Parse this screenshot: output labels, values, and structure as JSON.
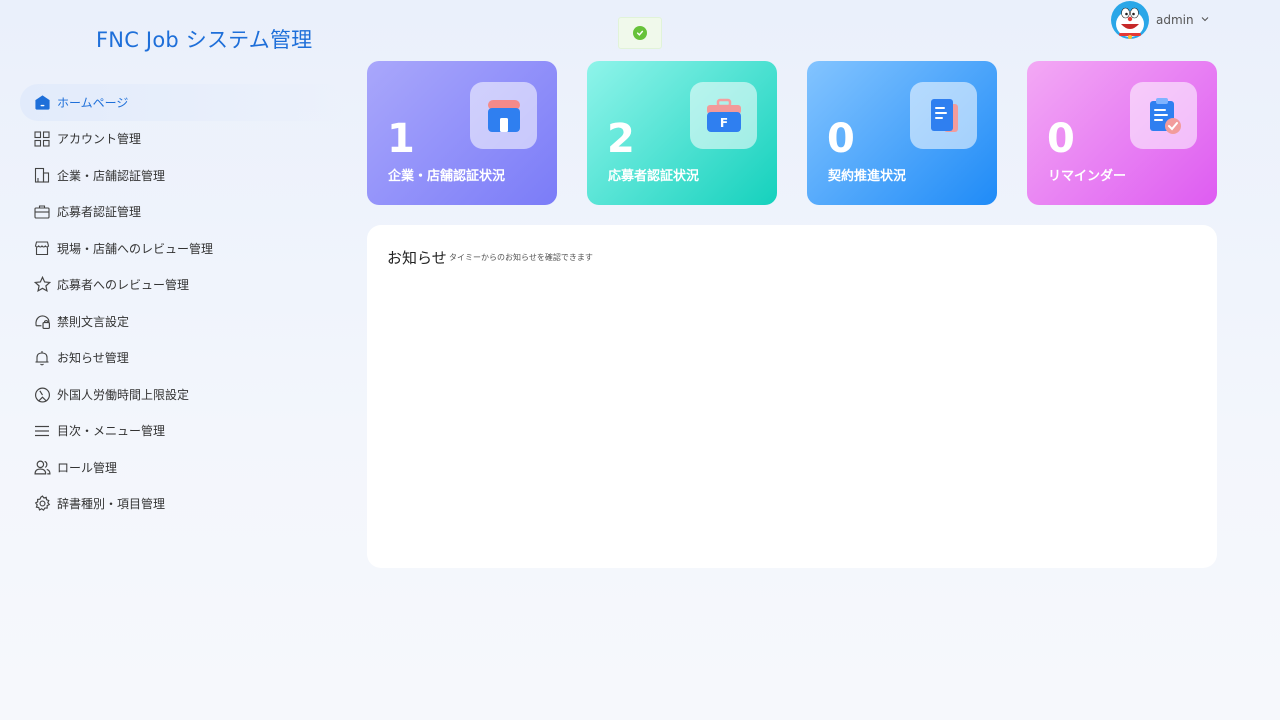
{
  "app": {
    "title": "FNC Job システム管理"
  },
  "user": {
    "name": "admin"
  },
  "sidebar": {
    "items": [
      {
        "label": "ホームページ",
        "icon": "home-icon",
        "active": true
      },
      {
        "label": "アカウント管理",
        "icon": "grid-icon"
      },
      {
        "label": "企業・店舗認証管理",
        "icon": "building-icon"
      },
      {
        "label": "応募者認証管理",
        "icon": "briefcase-icon"
      },
      {
        "label": "現場・店舗へのレビュー管理",
        "icon": "store-icon"
      },
      {
        "label": "応募者へのレビュー管理",
        "icon": "star-icon"
      },
      {
        "label": "禁則文言設定",
        "icon": "shield-text-icon"
      },
      {
        "label": "お知らせ管理",
        "icon": "bell-icon"
      },
      {
        "label": "外国人労働時間上限設定",
        "icon": "gauge-icon"
      },
      {
        "label": "目次・メニュー管理",
        "icon": "menu-icon"
      },
      {
        "label": "ロール管理",
        "icon": "users-icon"
      },
      {
        "label": "辞書種別・項目管理",
        "icon": "gear-icon"
      }
    ]
  },
  "cards": [
    {
      "value": "1",
      "label": "企業・店舗認証状況",
      "icon": "shop-icon"
    },
    {
      "value": "2",
      "label": "応募者認証状況",
      "icon": "bag-icon"
    },
    {
      "value": "0",
      "label": "契約推進状況",
      "icon": "document-icon"
    },
    {
      "value": "0",
      "label": "リマインダー",
      "icon": "clipboard-check-icon"
    }
  ],
  "notice": {
    "title": "お知らせ",
    "subtitle": "タイミーからのお知らせを確認できます"
  },
  "colors": {
    "accent": "#1e6fd9",
    "card1": "#7b7cf8",
    "card2": "#15d1bd",
    "card3": "#1f8bf7",
    "card4": "#de5cf2",
    "success": "#67c23a"
  }
}
